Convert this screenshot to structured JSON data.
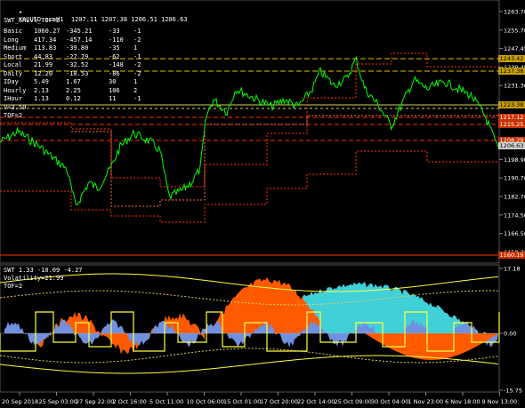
{
  "chart_header": {
    "symbol_icon": "dropdown-triangle-icon",
    "text": "XAUUSD.ecnH1  1207.11 1207.38 1206.51 1206.63"
  },
  "indicator_name": "SWT_SRLvl_TOF=2",
  "stats_table": [
    {
      "name": "Basic",
      "a": "1060.27",
      "b": "-345.21",
      "c": "-33",
      "d": "-1"
    },
    {
      "name": "Long",
      "a": "417.34",
      "b": "-457.14",
      "c": "-110",
      "d": "-2"
    },
    {
      "name": "Medium",
      "a": "113.83",
      "b": "-39.80",
      "c": "-35",
      "d": "1"
    },
    {
      "name": "Short",
      "a": "44.83",
      "b": "-27.79",
      "c": "-62",
      "d": "-1"
    },
    {
      "name": "Local",
      "a": "21.99",
      "b": "-32.52",
      "c": "-148",
      "d": "-2"
    },
    {
      "name": "Daily",
      "a": "12.20",
      "b": "-10.53",
      "c": "-86",
      "d": "-2"
    },
    {
      "name": "IDay",
      "a": "5.49",
      "b": "1.67",
      "c": "30",
      "d": "1"
    },
    {
      "name": "Hourly",
      "a": "2.13",
      "b": "2.25",
      "c": "106",
      "d": "2"
    },
    {
      "name": "IHour",
      "a": "1.13",
      "b": "0.12",
      "c": "11",
      "d": "-1"
    }
  ],
  "main_labels": {
    "v": "V=3.50",
    "tof": "TOF=2"
  },
  "price_axis": [
    "1263.70",
    "1255.70",
    "1247.45",
    "1239.45",
    "1231.30",
    "1223.38",
    "1215.35",
    "1207.13",
    "1198.90",
    "1190.70",
    "1182.70",
    "1174.50",
    "1166.50",
    "1158.30"
  ],
  "price_tags": [
    {
      "text": "1243.42",
      "bg": "#c8a000",
      "fg": "#000"
    },
    {
      "text": "1237.38",
      "bg": "#c8a000",
      "fg": "#000"
    },
    {
      "text": "1223.38",
      "bg": "#c8a000",
      "fg": "#000"
    },
    {
      "text": "1217.12",
      "bg": "#c83200",
      "fg": "#fff"
    },
    {
      "text": "1215.25",
      "bg": "#c83200",
      "fg": "#fff"
    },
    {
      "text": "1208.29",
      "bg": "#c83200",
      "fg": "#fff"
    },
    {
      "text": "1206.63",
      "bg": "#d0d0d0",
      "fg": "#000"
    },
    {
      "text": "1160.19",
      "bg": "#c83200",
      "fg": "#fff"
    }
  ],
  "sub_window": {
    "title": "SWT 1.33 -10.09 -4.27",
    "volatility": "Volatility=21.99",
    "tof": "TOF=2",
    "axis": [
      "17.18",
      "0.00",
      "-15.75"
    ]
  },
  "time_axis": [
    "20 Sep 2018",
    "25 Sep 03:00",
    "27 Sep 22:00",
    "2 Oct 16:00",
    "5 Oct 11:00",
    "10 Oct 06:00",
    "15 Oct 01:00",
    "17 Oct 20:00",
    "22 Oct 14:00",
    "25 Oct 09:00",
    "30 Oct 04:00",
    "1 Nov 23:00",
    "6 Nov 18:00",
    "9 Nov 13:00"
  ],
  "colors": {
    "background": "#000000",
    "price_line": "#00ff00",
    "resistance_yellow": "#e0c000",
    "support_red": "#ff3000",
    "cyan": "#40d0d8",
    "orange": "#ff5a00",
    "blue": "#7090e0",
    "yellow_line": "#ffff40"
  }
}
